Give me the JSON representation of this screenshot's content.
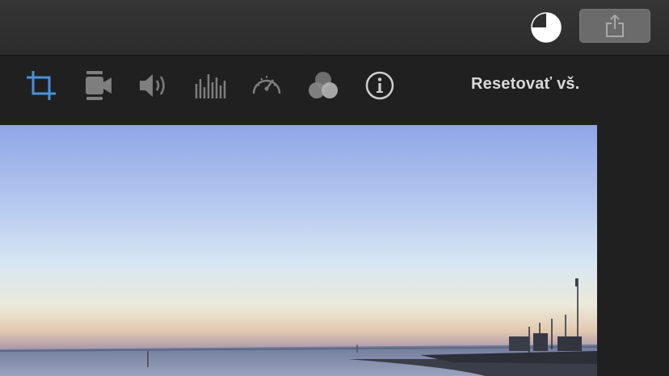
{
  "titlebar": {
    "progress_icon": "half-pie-progress-icon",
    "share_icon": "share-icon"
  },
  "toolbar": {
    "tools": [
      {
        "name": "crop",
        "icon": "crop-icon",
        "active": true
      },
      {
        "name": "stabilization",
        "icon": "video-camera-icon",
        "active": false
      },
      {
        "name": "volume",
        "icon": "speaker-icon",
        "active": false
      },
      {
        "name": "equalizer",
        "icon": "equalizer-icon",
        "active": false
      },
      {
        "name": "speed",
        "icon": "speedometer-icon",
        "active": false
      },
      {
        "name": "color",
        "icon": "color-circles-icon",
        "active": false
      },
      {
        "name": "info",
        "icon": "info-icon",
        "active": false
      }
    ],
    "reset_label": "Resetovať vš."
  },
  "colors": {
    "accent": "#4a90d9",
    "icon_inactive": "#7e7e7e",
    "icon_light": "#cfcfcf"
  }
}
